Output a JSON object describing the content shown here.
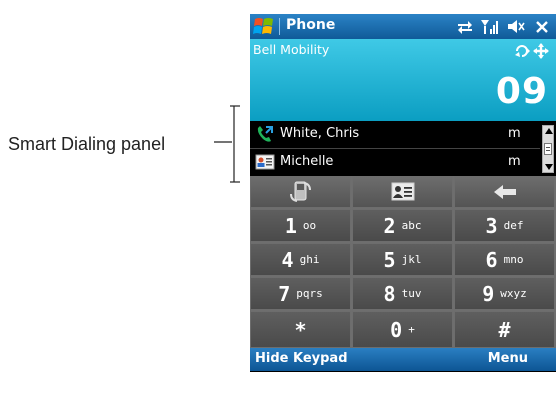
{
  "callout": {
    "label": "Smart Dialing panel"
  },
  "titlebar": {
    "title": "Phone",
    "icons": [
      "start-icon",
      "connectivity-icon",
      "signal-icon",
      "speaker-icon",
      "close-icon"
    ]
  },
  "caller": {
    "carrier": "Bell Mobility",
    "dialed_number": "09"
  },
  "smart_dialing": {
    "rows": [
      {
        "name": "White, Chris",
        "type": "m",
        "icon": "call-history-icon"
      },
      {
        "name": "Michelle",
        "type": "m",
        "icon": "contact-card-icon"
      }
    ]
  },
  "keypad": {
    "keys": [
      {
        "digit": "1",
        "letters": "oo"
      },
      {
        "digit": "2",
        "letters": "abc"
      },
      {
        "digit": "3",
        "letters": "def"
      },
      {
        "digit": "4",
        "letters": "ghi"
      },
      {
        "digit": "5",
        "letters": "jkl"
      },
      {
        "digit": "6",
        "letters": "mno"
      },
      {
        "digit": "7",
        "letters": "pqrs"
      },
      {
        "digit": "8",
        "letters": "tuv"
      },
      {
        "digit": "9",
        "letters": "wxyz"
      },
      {
        "digit": "*",
        "letters": ""
      },
      {
        "digit": "0",
        "letters": "+"
      },
      {
        "digit": "#",
        "letters": ""
      }
    ]
  },
  "softkeys": {
    "left": "Hide Keypad",
    "right": "Menu"
  }
}
